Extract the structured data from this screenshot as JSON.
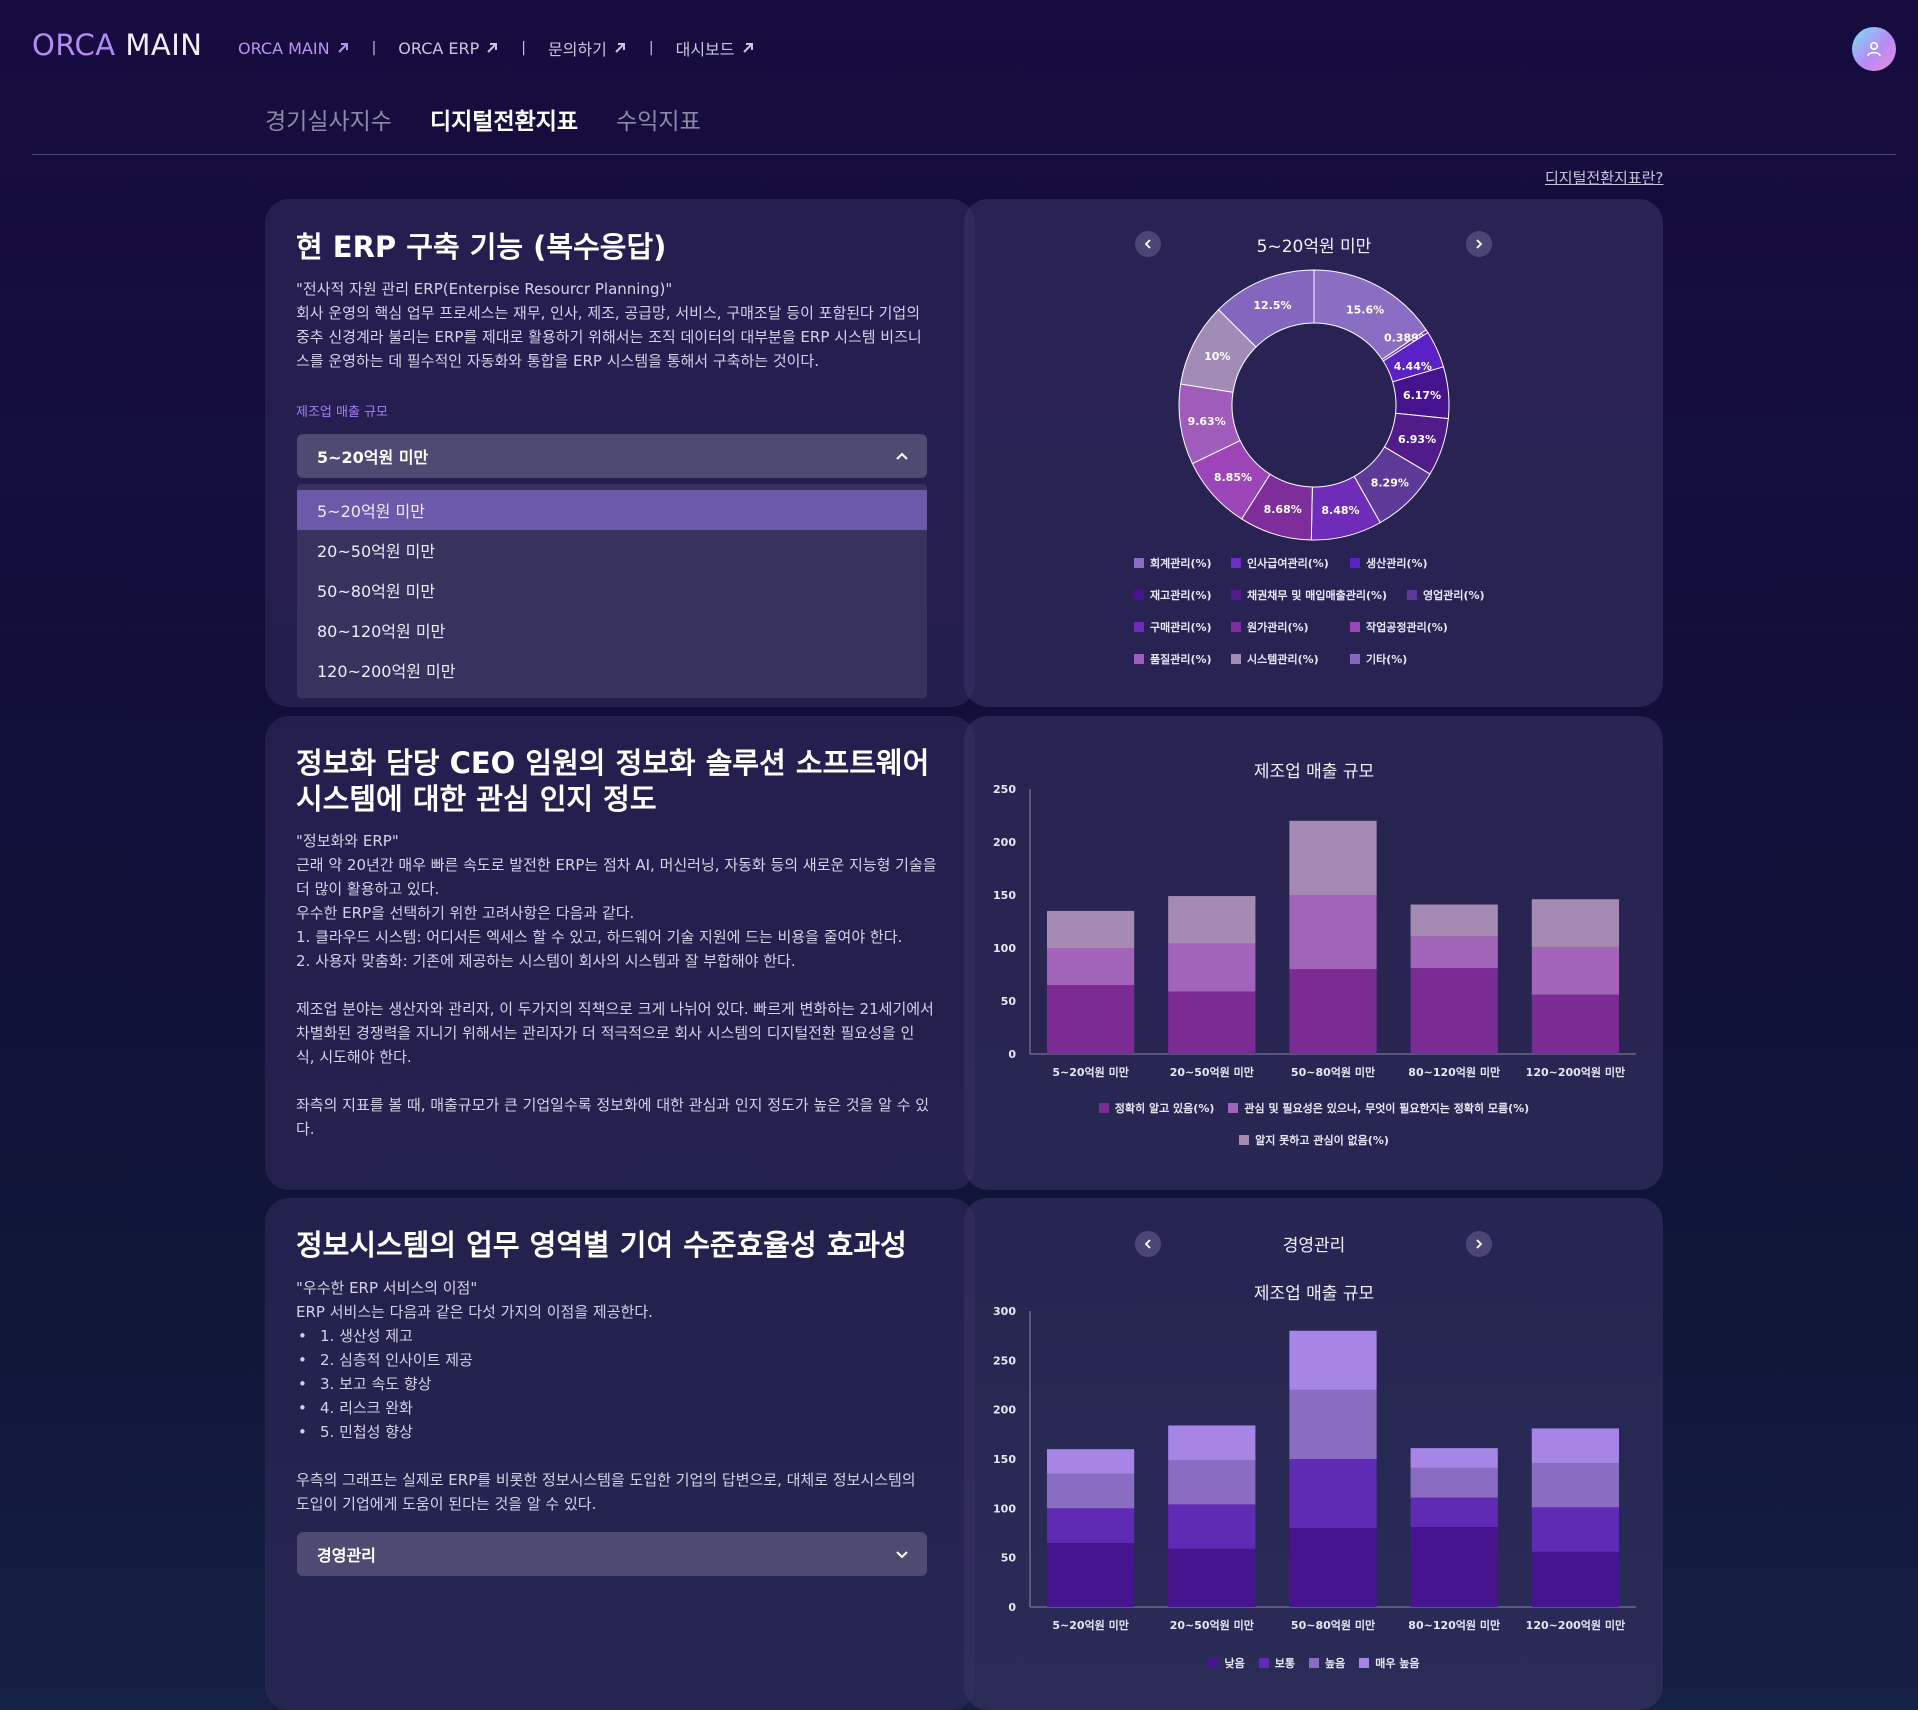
{
  "header": {
    "brand_part1": "ORCA",
    "brand_part2": "MAIN",
    "nav": [
      {
        "label": "ORCA MAIN",
        "active": true
      },
      {
        "label": "ORCA ERP",
        "active": false
      },
      {
        "label": "문의하기",
        "active": false
      },
      {
        "label": "대시보드",
        "active": false
      }
    ],
    "separator": "|",
    "avatar_icon": "user-icon"
  },
  "tabs": [
    {
      "label": "경기실사지수",
      "active": false
    },
    {
      "label": "디지털전환지표",
      "active": true
    },
    {
      "label": "수익지표",
      "active": false
    }
  ],
  "help_link": "디지털전환지표란?",
  "section1": {
    "title": "현 ERP 구축 기능 (복수응답)",
    "body": "\"전사적 자원 관리 ERP(Enterpise Resourcr Planning)\"\n회사 운영의 핵심 업무 프로세스는 재무, 인사, 제조, 공급망, 서비스, 구매조달 등이 포함된다 기업의\n중추 신경계라 불리는 ERP를 제대로 활용하기 위해서는 조직 데이터의 대부분을 ERP 시스템 비즈니\n스를 운영하는 데 필수적인 자동화와 통합을 ERP 시스템을 통해서 구축하는 것이다.",
    "filter_label": "제조업 매출 규모",
    "select_value": "5~20억원 미만",
    "options": [
      "5~20억원 미만",
      "20~50억원 미만",
      "50~80억원 미만",
      "80~120억원 미만",
      "120~200억원 미만"
    ],
    "selected_index": 0
  },
  "donut": {
    "title": "5~20억원 미만",
    "slices": [
      {
        "label": "회계관리(%)",
        "value": 15.6,
        "text": "15.6%",
        "color": "#8a6ec4"
      },
      {
        "label": "인사급여관리(%)",
        "value": 0.389,
        "text": "0.389%",
        "color": "#6a2ec6"
      },
      {
        "label": "생산관리(%)",
        "value": 4.44,
        "text": "4.44%",
        "color": "#5a22c4"
      },
      {
        "label": "재고관리(%)",
        "value": 6.17,
        "text": "6.17%",
        "color": "#46138f"
      },
      {
        "label": "채권채무 및 매입매출관리(%)",
        "value": 6.93,
        "text": "6.93%",
        "color": "#4f1c8a"
      },
      {
        "label": "영업관리(%)",
        "value": 8.29,
        "text": "8.29%",
        "color": "#5d3a98"
      },
      {
        "label": "구매관리(%)",
        "value": 8.48,
        "text": "8.48%",
        "color": "#6e2cb8"
      },
      {
        "label": "원가관리(%)",
        "value": 8.68,
        "text": "8.68%",
        "color": "#7e2e9a"
      },
      {
        "label": "작업공정관리(%)",
        "value": 8.85,
        "text": "8.85%",
        "color": "#9b45b8"
      },
      {
        "label": "품질관리(%)",
        "value": 9.63,
        "text": "9.63%",
        "color": "#a05cbb"
      },
      {
        "label": "시스템관리(%)",
        "value": 10,
        "text": "10%",
        "color": "#a38bb8"
      },
      {
        "label": "기타(%)",
        "value": 12.5,
        "text": "12.5%",
        "color": "#8466bf"
      }
    ]
  },
  "section2": {
    "title_line1": "정보화 담당 CEO 임원의 정보화 솔루션 소프트웨어",
    "title_line2": "시스템에 대한 관심 인지 정도",
    "body": "\"정보화와 ERP\"\n근래 약 20년간 매우 빠른 속도로 발전한 ERP는 점차 AI, 머신러닝, 자동화 등의 새로운 지능형 기술을\n더 많이 활용하고 있다.\n우수한 ERP을 선택하기 위한 고려사항은 다음과 같다.\n1. 클라우드 시스템: 어디서든 엑세스 할 수 있고, 하드웨어 기술 지원에 드는 비용을 줄여야 한다.\n2. 사용자 맞춤화: 기존에 제공하는 시스템이 회사의 시스템과 잘 부합해야 한다.\n\n제조업 분야는 생산자와 관리자, 이 두가지의 직책으로 크게 나뉘어 있다. 빠르게 변화하는 21세기에서\n차별화된 경쟁력을 지니기 위해서는 관리자가 더 적극적으로 회사 시스템의 디지털전환 필요성을 인\n식, 시도해야 한다.\n\n좌측의 지표를 볼 때, 매출규모가 큰 기업일수록 정보화에 대한 관심과 인지 정도가 높은 것을 알 수 있\n다."
  },
  "chart_data": [
    {
      "type": "pie",
      "title": "5~20억원 미만",
      "categories": [
        "회계관리(%)",
        "인사급여관리(%)",
        "생산관리(%)",
        "재고관리(%)",
        "채권채무 및 매입매출관리(%)",
        "영업관리(%)",
        "구매관리(%)",
        "원가관리(%)",
        "작업공정관리(%)",
        "품질관리(%)",
        "시스템관리(%)",
        "기타(%)"
      ],
      "values": [
        15.6,
        0.389,
        4.44,
        6.17,
        6.93,
        8.29,
        8.48,
        8.68,
        8.85,
        9.63,
        10,
        12.5
      ]
    },
    {
      "type": "bar",
      "stacked": true,
      "title": "제조업 매출 규모",
      "categories": [
        "5~20억원 미만",
        "20~50억원 미만",
        "50~80억원 미만",
        "80~120억원 미만",
        "120~200억원 미만"
      ],
      "ylim": [
        0,
        250
      ],
      "yticks": [
        0,
        50,
        100,
        150,
        200,
        250
      ],
      "series": [
        {
          "name": "정확히 알고 있음(%)",
          "values": [
            65,
            59,
            80,
            81,
            56
          ],
          "color": "#7b2c94"
        },
        {
          "name": "관심 및 필요성은 있으나, 무엇이 필요한지는 정확히 모름(%)",
          "values": [
            35,
            45,
            70,
            30,
            45
          ],
          "color": "#a264b8"
        },
        {
          "name": "알지 못하고 관심이 없음(%)",
          "values": [
            35,
            45,
            70,
            30,
            45
          ],
          "color": "#a58ab3"
        }
      ]
    },
    {
      "type": "bar",
      "stacked": true,
      "title": "제조업 매출 규모",
      "subtitle": "경영관리",
      "categories": [
        "5~20억원 미만",
        "20~50억원 미만",
        "50~80억원 미만",
        "80~120억원 미만",
        "120~200억원 미만"
      ],
      "ylim": [
        0,
        300
      ],
      "yticks": [
        0,
        50,
        100,
        150,
        200,
        250,
        300
      ],
      "series": [
        {
          "name": "낮음",
          "values": [
            65,
            59,
            80,
            81,
            56
          ],
          "color": "#46148f"
        },
        {
          "name": "보통",
          "values": [
            35,
            45,
            70,
            30,
            45
          ],
          "color": "#5f2bb4"
        },
        {
          "name": "높음",
          "values": [
            35,
            45,
            70,
            30,
            45
          ],
          "color": "#8a6cc2"
        },
        {
          "name": "매우 높음",
          "values": [
            25,
            35,
            60,
            20,
            35
          ],
          "color": "#a685e6"
        }
      ]
    }
  ],
  "section3": {
    "title": "정보시스템의 업무 영역별 기여 수준효율성 효과성",
    "intro": "\"우수한 ERP 서비스의 이점\"\nERP 서비스는 다음과 같은 다섯 가지의 이점을 제공한다.",
    "benefits": [
      "1. 생산성 제고",
      "2. 심층적 인사이트 제공",
      "3. 보고 속도 향상",
      "4. 리스크 완화",
      "5. 민첩성 향상"
    ],
    "outro": "우측의 그래프는 실제로 ERP를 비롯한 정보시스템을 도입한 기업의 답변으로, 대체로 정보시스템의\n도입이 기업에게 도움이 된다는 것을 알 수 있다.",
    "select_value": "경영관리"
  },
  "chart3_header": "경영관리"
}
